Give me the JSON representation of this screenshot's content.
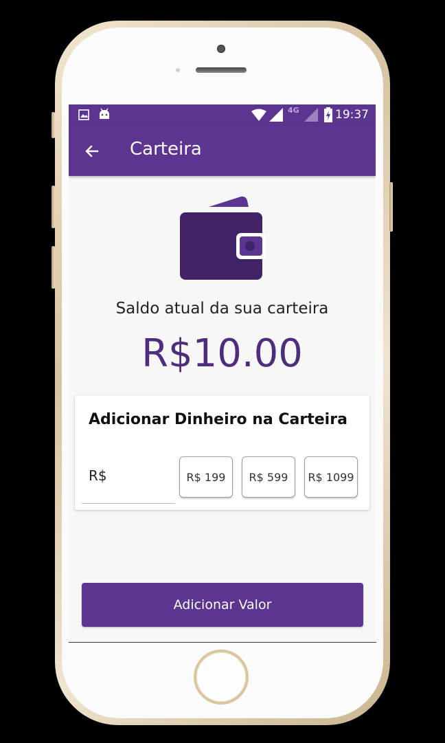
{
  "status_bar": {
    "time": "19:37",
    "network_label": "4G",
    "icons": [
      "image-icon",
      "android-icon",
      "wifi-icon",
      "signal-icon",
      "signal-icon",
      "battery-charging-icon"
    ]
  },
  "app_bar": {
    "title": "Carteira",
    "back_icon": "arrow-left-icon"
  },
  "wallet": {
    "icon": "wallet-icon",
    "balance_label": "Saldo atual da sua carteira",
    "balance_value": "R$10.00"
  },
  "add_money_card": {
    "title": "Adicionar Dinheiro na Carteira",
    "amount_prefix": "R$",
    "amount_value": "",
    "quick_amounts": [
      "R$ 199",
      "R$ 599",
      "R$ 1099"
    ]
  },
  "actions": {
    "submit_label": "Adicionar Valor"
  },
  "colors": {
    "primary": "#5b3590",
    "balance_text": "#4e2d7c",
    "wallet_dark": "#3f2366"
  }
}
